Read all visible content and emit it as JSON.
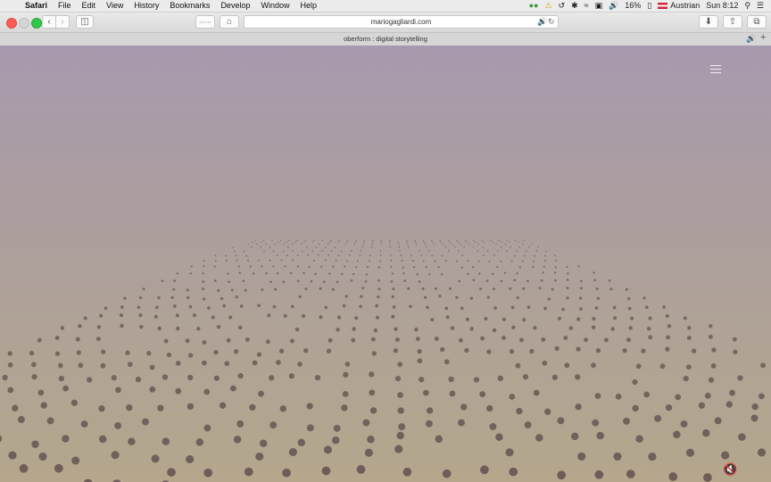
{
  "menubar": {
    "app_name": "Safari",
    "menus": [
      "File",
      "Edit",
      "View",
      "History",
      "Bookmarks",
      "Develop",
      "Window",
      "Help"
    ],
    "battery_percent": "16%",
    "input_source": "Austrian",
    "clock": "Sun 8:12"
  },
  "toolbar": {
    "url": "mariogagliardi.com"
  },
  "tab": {
    "title": "oberform : digital storytelling"
  },
  "colors": {
    "dot": "#6e5c58",
    "page_top": "#a89aae",
    "page_bottom": "#b4a78c"
  }
}
